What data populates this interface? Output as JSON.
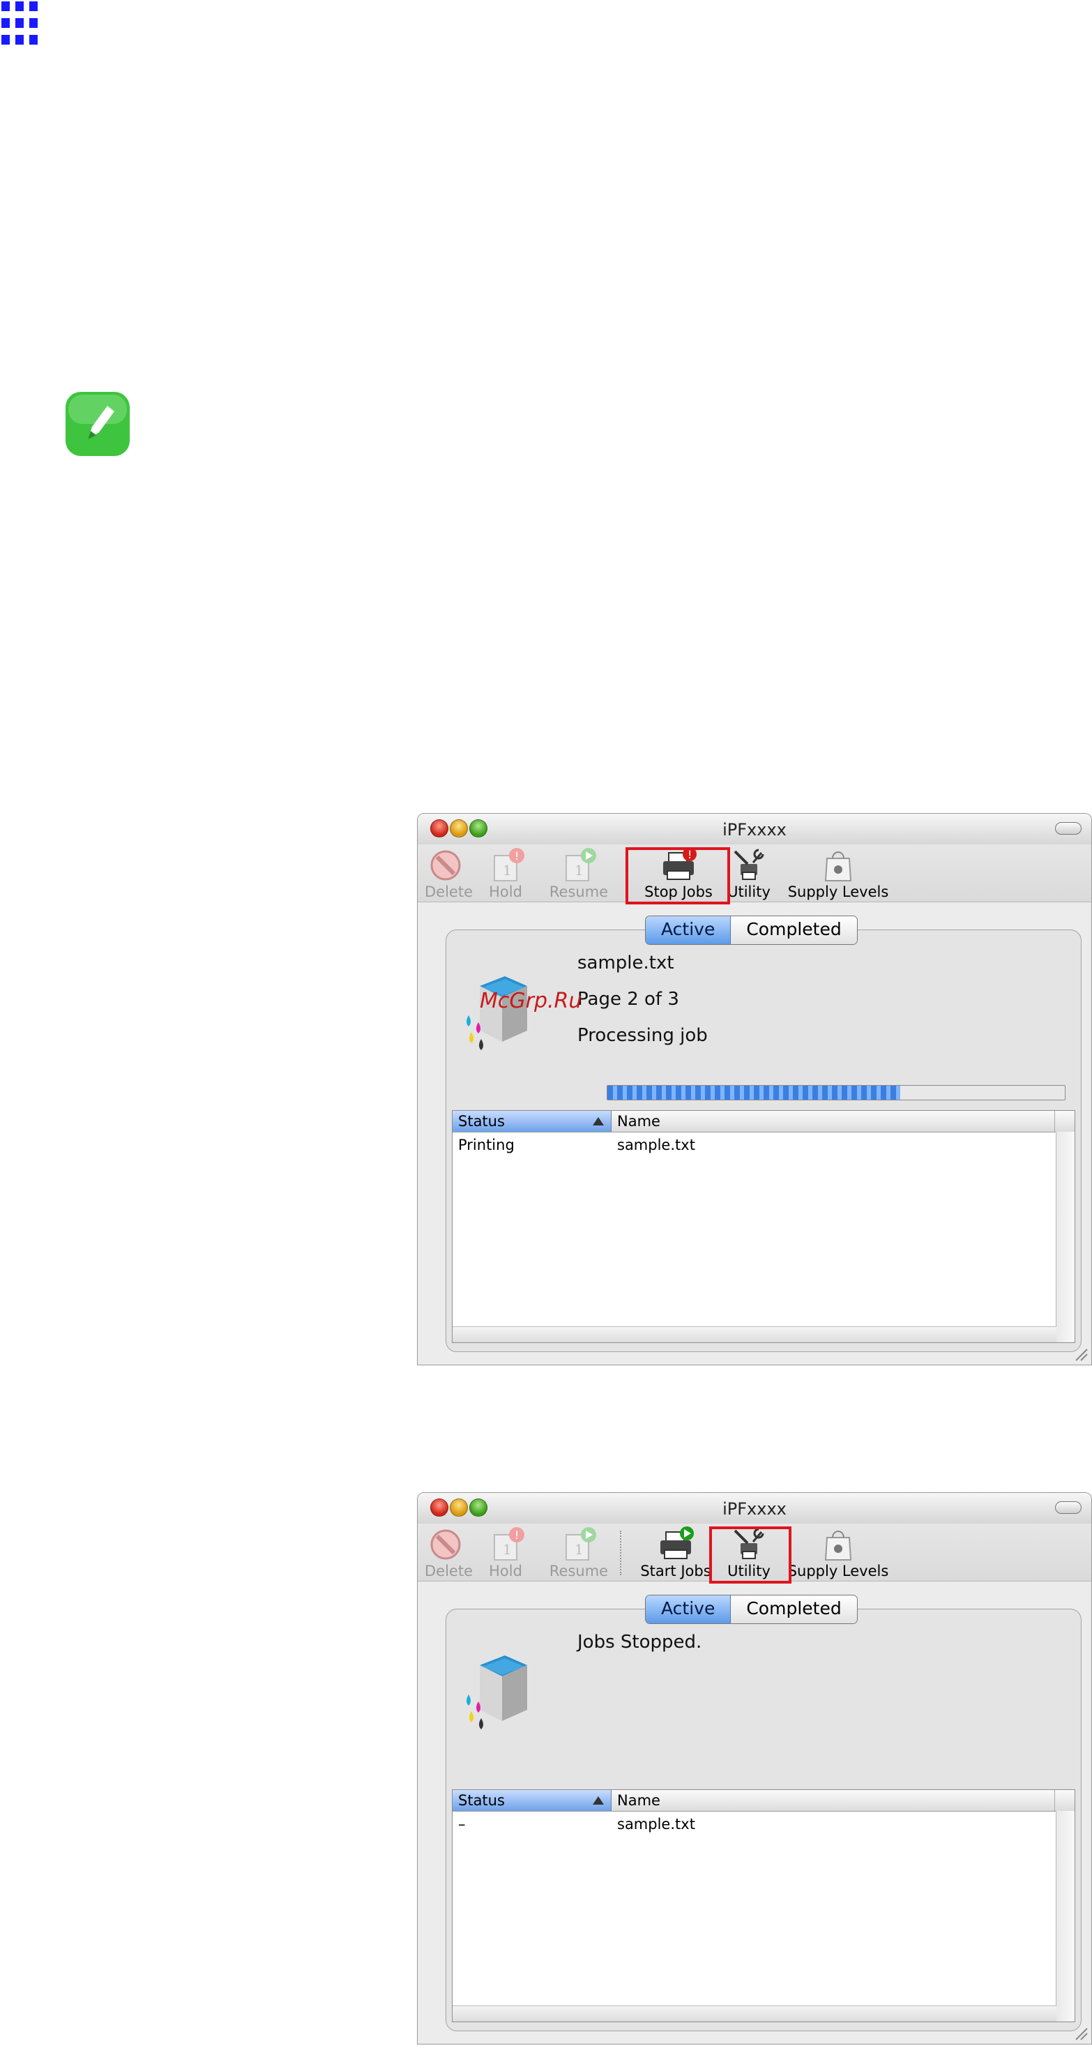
{
  "window_one": {
    "title": "iPFxxxx",
    "toolbar": {
      "delete": "Delete",
      "hold": "Hold",
      "resume": "Resume",
      "stop_jobs": "Stop Jobs",
      "utility": "Utility",
      "supply_levels": "Supply Levels"
    },
    "tabs": {
      "active": "Active",
      "completed": "Completed"
    },
    "job": {
      "file": "sample.txt",
      "page": "Page 2 of 3",
      "status": "Processing job",
      "progress": 0.64
    },
    "table": {
      "col_status": "Status",
      "col_name": "Name",
      "rows": [
        {
          "status": "Printing",
          "name": "sample.txt"
        }
      ]
    },
    "watermark": "McGrp.Ru"
  },
  "window_two": {
    "title": "iPFxxxx",
    "toolbar": {
      "delete": "Delete",
      "hold": "Hold",
      "resume": "Resume",
      "start_jobs": "Start Jobs",
      "utility": "Utility",
      "supply_levels": "Supply Levels"
    },
    "tabs": {
      "active": "Active",
      "completed": "Completed"
    },
    "job": {
      "status": "Jobs Stopped."
    },
    "table": {
      "col_status": "Status",
      "col_name": "Name",
      "rows": [
        {
          "status": "–",
          "name": "sample.txt"
        }
      ]
    }
  },
  "colors": {
    "highlight": "#e0141e",
    "grid_logo": "#1a1aff",
    "note_icon": "#3ec43e",
    "selection": "#5d9be8"
  }
}
